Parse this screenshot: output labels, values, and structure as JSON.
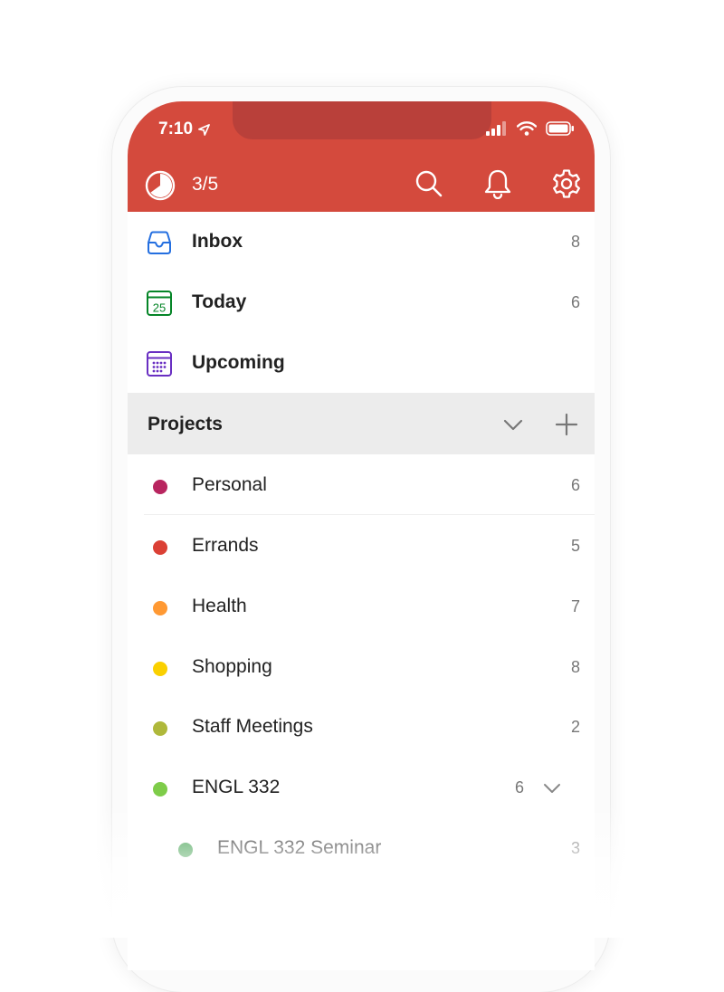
{
  "status_bar": {
    "time": "7:10"
  },
  "header": {
    "progress": "3/5"
  },
  "nav": [
    {
      "label": "Inbox",
      "count": "8"
    },
    {
      "label": "Today",
      "count": "6",
      "icon_text": "25"
    },
    {
      "label": "Upcoming",
      "count": ""
    }
  ],
  "projects": {
    "title": "Projects",
    "items": [
      {
        "name": "Personal",
        "count": "6",
        "color": "#b8255f"
      },
      {
        "name": "Errands",
        "count": "5",
        "color": "#db4035"
      },
      {
        "name": "Health",
        "count": "7",
        "color": "#ff9933"
      },
      {
        "name": "Shopping",
        "count": "8",
        "color": "#fad000"
      },
      {
        "name": "Staff Meetings",
        "count": "2",
        "color": "#afb83b"
      },
      {
        "name": "ENGL 332",
        "count": "6",
        "color": "#7ecc49"
      },
      {
        "name": "ENGL 332 Seminar",
        "count": "3",
        "color": "#299438"
      }
    ]
  },
  "colors": {
    "accent": "#db4c3f",
    "inbox": "#246fe0",
    "today": "#058527",
    "upcoming": "#692fc2"
  }
}
